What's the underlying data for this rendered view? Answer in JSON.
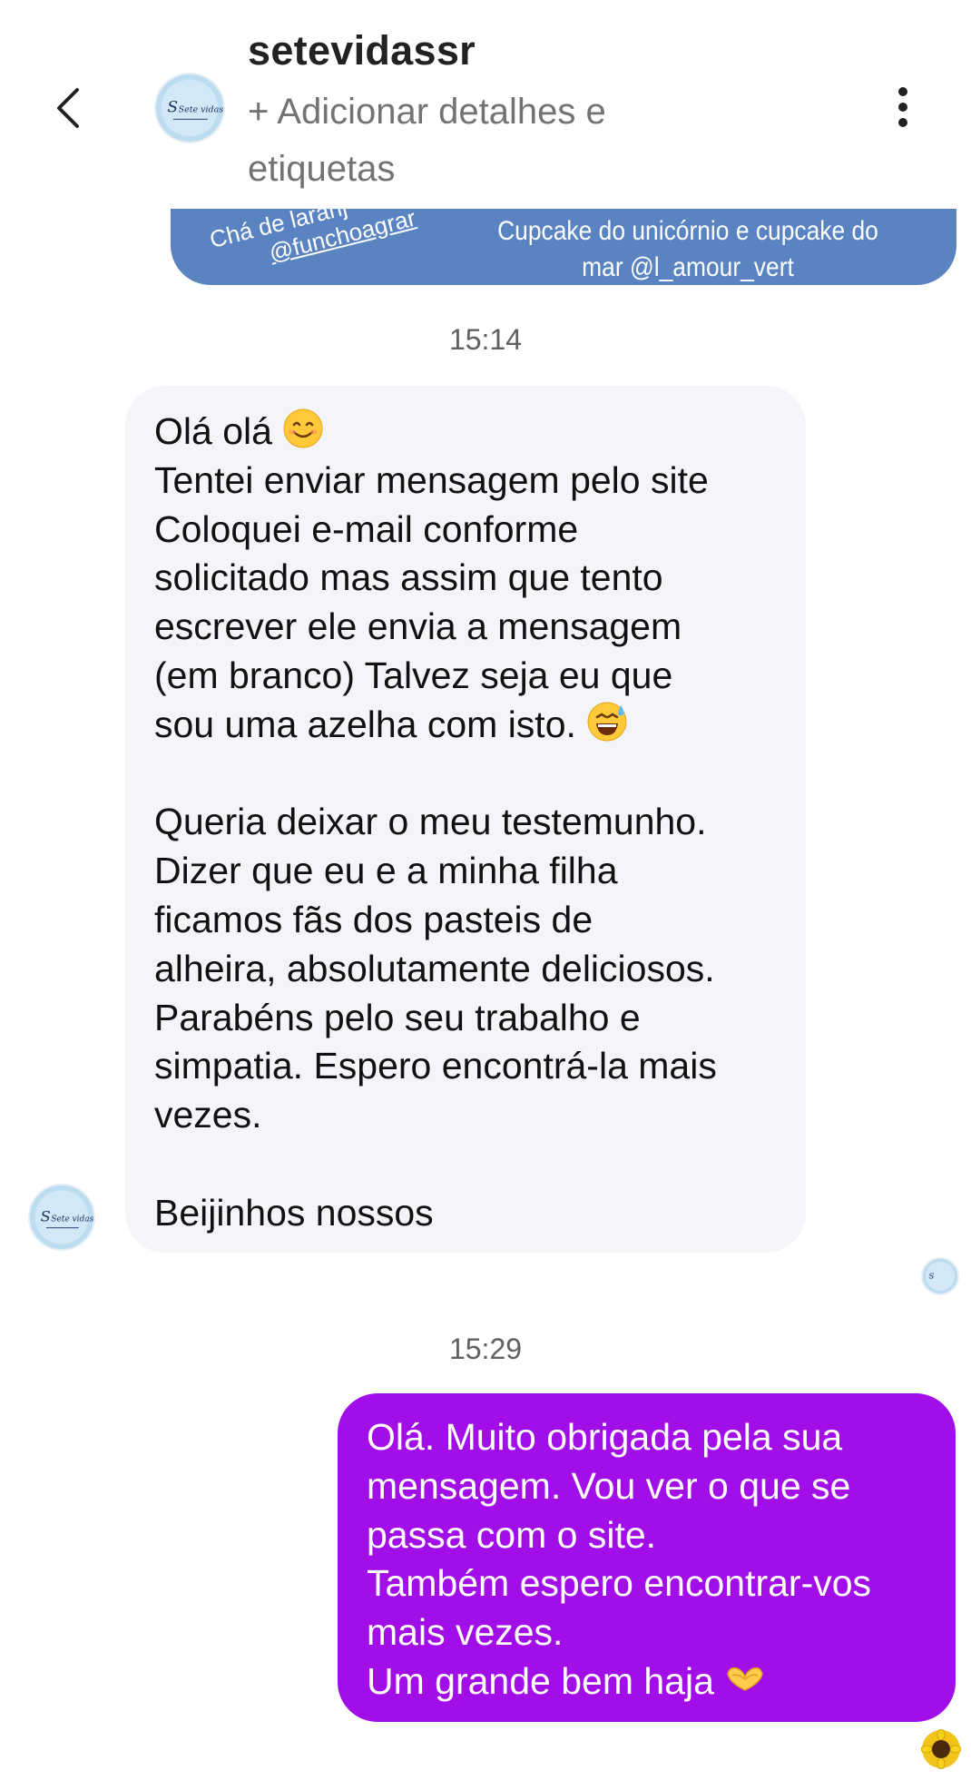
{
  "header": {
    "back_icon": "chevron-left-icon",
    "name": "setevidassr",
    "subtitle": "+ Adicionar detalhes e etiquetas",
    "subtitle_lines": [
      "+ Adicionar detalhes e",
      "etiquetas"
    ],
    "menu_icon": "more-vertical-icon",
    "avatar_logo_text": "Sete vidas"
  },
  "story_preview": {
    "left_caption_1": "Chá de laranj",
    "left_caption_2": "@funchoagrar",
    "right_caption_1": "Cupcake do unicórnio e cupcake do",
    "right_caption_2": "mar @l_amour_vert"
  },
  "timestamps": [
    "15:14",
    "15:29"
  ],
  "incoming_message": {
    "lines": [
      "Olá olá",
      "Tentei enviar mensagem pelo site",
      "Coloquei e-mail conforme",
      "solicitado mas assim que tento",
      "escrever ele envia a mensagem",
      "(em branco) Talvez seja eu que",
      "sou uma azelha com isto.",
      "",
      "Queria deixar o meu testemunho.",
      "Dizer que eu e a minha filha",
      "ficamos fãs dos pasteis de",
      "alheira, absolutamente deliciosos.",
      "Parabéns pelo seu trabalho e",
      "simpatia. Espero encontrá-la mais",
      "vezes.",
      "",
      "Beijinhos nossos"
    ],
    "emoji_line_0": "smiling-face-icon",
    "emoji_line_6": "grinning-sweat-icon"
  },
  "outgoing_message": {
    "lines": [
      "Olá. Muito obrigada pela sua",
      "mensagem. Vou ver o que se",
      "passa com o site.",
      "Também espero encontrar-vos",
      "mais vezes.",
      "Um grande bem haja"
    ],
    "emoji_last_line": "heart-hands-icon"
  },
  "colors": {
    "incoming_bubble": "#f4f5f8",
    "outgoing_bubble": "#a10ee8",
    "story_card": "#5a83c2",
    "timestamp": "#606060"
  }
}
